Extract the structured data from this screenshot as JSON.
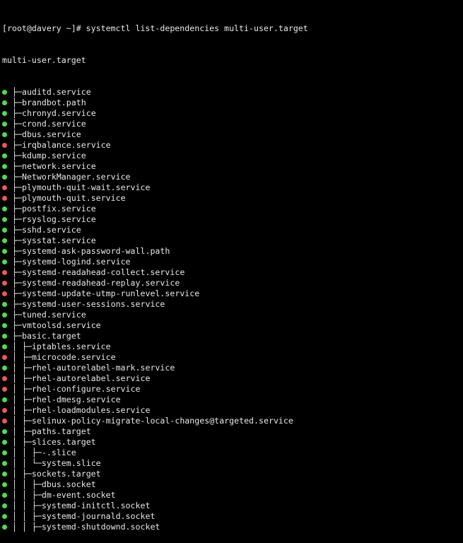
{
  "colors": {
    "active": "#4fdc4f",
    "failed": "#e85a5a",
    "text": "#e8e8e8",
    "background": "#000000"
  },
  "prompt": "[root@davery ~]# systemctl list-dependencies multi-user.target",
  "root_unit": "multi-user.target",
  "units": [
    {
      "prefix": "├─",
      "name": "auditd.service",
      "status": "active"
    },
    {
      "prefix": "├─",
      "name": "brandbot.path",
      "status": "active"
    },
    {
      "prefix": "├─",
      "name": "chronyd.service",
      "status": "active"
    },
    {
      "prefix": "├─",
      "name": "crond.service",
      "status": "active"
    },
    {
      "prefix": "├─",
      "name": "dbus.service",
      "status": "active"
    },
    {
      "prefix": "├─",
      "name": "irqbalance.service",
      "status": "failed"
    },
    {
      "prefix": "├─",
      "name": "kdump.service",
      "status": "active"
    },
    {
      "prefix": "├─",
      "name": "network.service",
      "status": "active"
    },
    {
      "prefix": "├─",
      "name": "NetworkManager.service",
      "status": "active"
    },
    {
      "prefix": "├─",
      "name": "plymouth-quit-wait.service",
      "status": "failed"
    },
    {
      "prefix": "├─",
      "name": "plymouth-quit.service",
      "status": "failed"
    },
    {
      "prefix": "├─",
      "name": "postfix.service",
      "status": "active"
    },
    {
      "prefix": "├─",
      "name": "rsyslog.service",
      "status": "active"
    },
    {
      "prefix": "├─",
      "name": "sshd.service",
      "status": "active"
    },
    {
      "prefix": "├─",
      "name": "sysstat.service",
      "status": "active"
    },
    {
      "prefix": "├─",
      "name": "systemd-ask-password-wall.path",
      "status": "active"
    },
    {
      "prefix": "├─",
      "name": "systemd-logind.service",
      "status": "active"
    },
    {
      "prefix": "├─",
      "name": "systemd-readahead-collect.service",
      "status": "failed"
    },
    {
      "prefix": "├─",
      "name": "systemd-readahead-replay.service",
      "status": "failed"
    },
    {
      "prefix": "├─",
      "name": "systemd-update-utmp-runlevel.service",
      "status": "failed"
    },
    {
      "prefix": "├─",
      "name": "systemd-user-sessions.service",
      "status": "active"
    },
    {
      "prefix": "├─",
      "name": "tuned.service",
      "status": "active"
    },
    {
      "prefix": "├─",
      "name": "vmtoolsd.service",
      "status": "active"
    },
    {
      "prefix": "├─",
      "name": "basic.target",
      "status": "active"
    },
    {
      "prefix": "│ ├─",
      "name": "iptables.service",
      "status": "active"
    },
    {
      "prefix": "│ ├─",
      "name": "microcode.service",
      "status": "failed"
    },
    {
      "prefix": "│ ├─",
      "name": "rhel-autorelabel-mark.service",
      "status": "active"
    },
    {
      "prefix": "│ ├─",
      "name": "rhel-autorelabel.service",
      "status": "failed"
    },
    {
      "prefix": "│ ├─",
      "name": "rhel-configure.service",
      "status": "failed"
    },
    {
      "prefix": "│ ├─",
      "name": "rhel-dmesg.service",
      "status": "active"
    },
    {
      "prefix": "│ ├─",
      "name": "rhel-loadmodules.service",
      "status": "failed"
    },
    {
      "prefix": "│ ├─",
      "name": "selinux-policy-migrate-local-changes@targeted.service",
      "status": "failed"
    },
    {
      "prefix": "│ ├─",
      "name": "paths.target",
      "status": "active"
    },
    {
      "prefix": "│ ├─",
      "name": "slices.target",
      "status": "active"
    },
    {
      "prefix": "│ │ ├─",
      "name": "-.slice",
      "status": "active"
    },
    {
      "prefix": "│ │ └─",
      "name": "system.slice",
      "status": "active"
    },
    {
      "prefix": "│ ├─",
      "name": "sockets.target",
      "status": "active"
    },
    {
      "prefix": "│ │ ├─",
      "name": "dbus.socket",
      "status": "active"
    },
    {
      "prefix": "│ │ ├─",
      "name": "dm-event.socket",
      "status": "active"
    },
    {
      "prefix": "│ │ ├─",
      "name": "systemd-initctl.socket",
      "status": "active"
    },
    {
      "prefix": "│ │ ├─",
      "name": "systemd-journald.socket",
      "status": "active"
    },
    {
      "prefix": "│ │ ├─",
      "name": "systemd-shutdownd.socket",
      "status": "active"
    }
  ]
}
